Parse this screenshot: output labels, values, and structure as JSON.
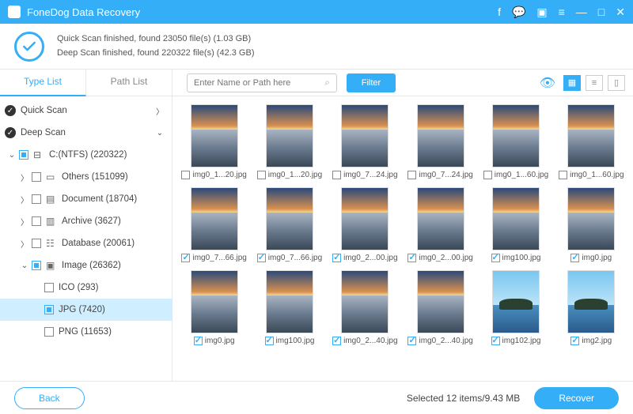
{
  "app": {
    "title": "FoneDog Data Recovery"
  },
  "status": {
    "line1": "Quick Scan finished, found 23050 file(s) (1.03 GB)",
    "line2": "Deep Scan finished, found 220322 file(s) (42.3 GB)"
  },
  "tabs": {
    "type_list": "Type List",
    "path_list": "Path List"
  },
  "search": {
    "placeholder": "Enter Name or Path here"
  },
  "filter": "Filter",
  "tree": {
    "quick_scan": "Quick Scan",
    "deep_scan": "Deep Scan",
    "drive": "C:(NTFS) (220322)",
    "others": "Others (151099)",
    "document": "Document (18704)",
    "archive": "Archive (3627)",
    "database": "Database (20061)",
    "image": "Image (26362)",
    "ico": "ICO (293)",
    "jpg": "JPG (7420)",
    "png": "PNG (11653)"
  },
  "thumbs": [
    {
      "name": "img0_1...20.jpg",
      "checked": false,
      "variant": "sunset"
    },
    {
      "name": "img0_1...20.jpg",
      "checked": false,
      "variant": "sunset"
    },
    {
      "name": "img0_7...24.jpg",
      "checked": false,
      "variant": "sunset"
    },
    {
      "name": "img0_7...24.jpg",
      "checked": false,
      "variant": "sunset"
    },
    {
      "name": "img0_1...60.jpg",
      "checked": false,
      "variant": "sunset"
    },
    {
      "name": "img0_1...60.jpg",
      "checked": false,
      "variant": "sunset"
    },
    {
      "name": "img0_7...66.jpg",
      "checked": true,
      "variant": "sunset"
    },
    {
      "name": "img0_7...66.jpg",
      "checked": true,
      "variant": "sunset"
    },
    {
      "name": "img0_2...00.jpg",
      "checked": true,
      "variant": "sunset"
    },
    {
      "name": "img0_2...00.jpg",
      "checked": true,
      "variant": "sunset"
    },
    {
      "name": "img100.jpg",
      "checked": true,
      "variant": "sunset"
    },
    {
      "name": "img0.jpg",
      "checked": true,
      "variant": "sunset"
    },
    {
      "name": "img0.jpg",
      "checked": true,
      "variant": "sunset"
    },
    {
      "name": "img100.jpg",
      "checked": true,
      "variant": "sunset"
    },
    {
      "name": "img0_2...40.jpg",
      "checked": true,
      "variant": "sunset"
    },
    {
      "name": "img0_2...40.jpg",
      "checked": true,
      "variant": "sunset"
    },
    {
      "name": "img102.jpg",
      "checked": true,
      "variant": "island"
    },
    {
      "name": "img2.jpg",
      "checked": true,
      "variant": "island"
    }
  ],
  "footer": {
    "back": "Back",
    "selected": "Selected 12 items/9.43 MB",
    "recover": "Recover"
  }
}
